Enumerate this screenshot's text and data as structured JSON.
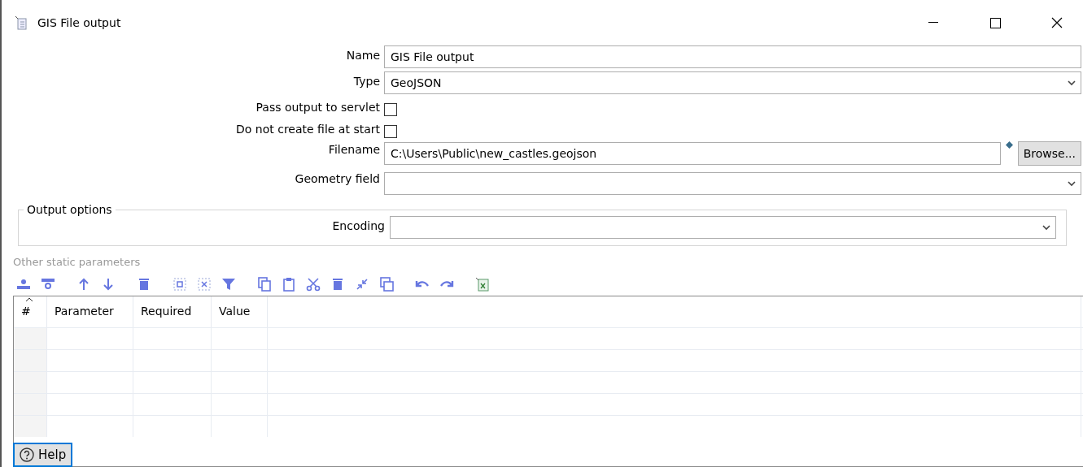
{
  "window": {
    "title": "GIS File output"
  },
  "form": [
    {
      "kind": "text",
      "label": "Name",
      "value": "GIS File output"
    },
    {
      "kind": "select",
      "label": "Type",
      "value": "GeoJSON"
    },
    {
      "kind": "checkbox",
      "label": "Pass output to servlet",
      "checked": false
    },
    {
      "kind": "checkbox",
      "label": "Do not create file at start",
      "checked": false
    },
    {
      "kind": "file",
      "label": "Filename",
      "value": "C:\\Users\\Public\\new_castles.geojson",
      "button": "Browse..."
    },
    {
      "kind": "select",
      "label": "Geometry field"
    }
  ],
  "output_options": {
    "title": "Output options",
    "fields": [
      {
        "kind": "select",
        "label": "Encoding"
      }
    ]
  },
  "parameters": {
    "title": "Other static parameters",
    "columns": [
      "#",
      "Parameter",
      "Required",
      "Value"
    ]
  },
  "help_button": "Help"
}
